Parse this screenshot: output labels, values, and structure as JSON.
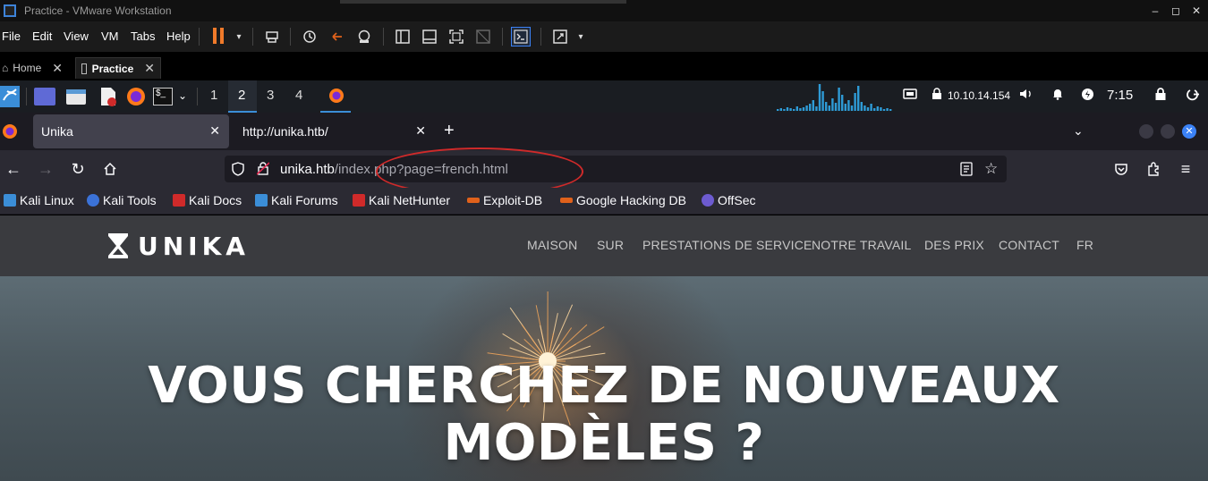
{
  "vmware": {
    "title": "Practice - VMware Workstation",
    "window_controls": [
      "–",
      "◻",
      "✕"
    ],
    "menu": [
      "File",
      "Edit",
      "View",
      "VM",
      "Tabs",
      "Help"
    ],
    "tabs": [
      {
        "label": "Home",
        "icon": "home-icon"
      },
      {
        "label": "Practice",
        "icon": "vm-icon"
      }
    ]
  },
  "kali_panel": {
    "workspaces": [
      "1",
      "2",
      "3",
      "4"
    ],
    "active_workspace": "2",
    "ip": "10.10.14.154",
    "time": "7:15",
    "accent": "#3b8ed8"
  },
  "firefox": {
    "tabs": [
      {
        "label": "Unika",
        "close": "✕"
      },
      {
        "label": "http://unika.htb/",
        "close": "✕"
      }
    ],
    "new_tab": "+",
    "url_host": "unika.htb",
    "url_path": "/index.php?page=french.html",
    "bookmarks": [
      {
        "label": "Kali Linux",
        "color": "#3b8ed8"
      },
      {
        "label": "Kali Tools",
        "color": "#3b72d8"
      },
      {
        "label": "Kali Docs",
        "color": "#d02a2a"
      },
      {
        "label": "Kali Forums",
        "color": "#3b8ed8"
      },
      {
        "label": "Kali NetHunter",
        "color": "#d02a2a"
      },
      {
        "label": "Exploit-DB",
        "color": "#e0611b"
      },
      {
        "label": "Google Hacking DB",
        "color": "#e0611b"
      },
      {
        "label": "OffSec",
        "color": "#6d5bd0"
      }
    ],
    "annotation_color": "#d02a2a"
  },
  "site": {
    "logo": "UNIKA",
    "nav": [
      "MAISON",
      "SUR",
      "PRESTATIONS DE SERVICE",
      "NOTRE TRAVAIL",
      "DES PRIX",
      "CONTACT",
      "FR"
    ],
    "hero_line1": "VOUS CHERCHEZ DE NOUVEAUX",
    "hero_line2": "MODÈLES ?"
  }
}
